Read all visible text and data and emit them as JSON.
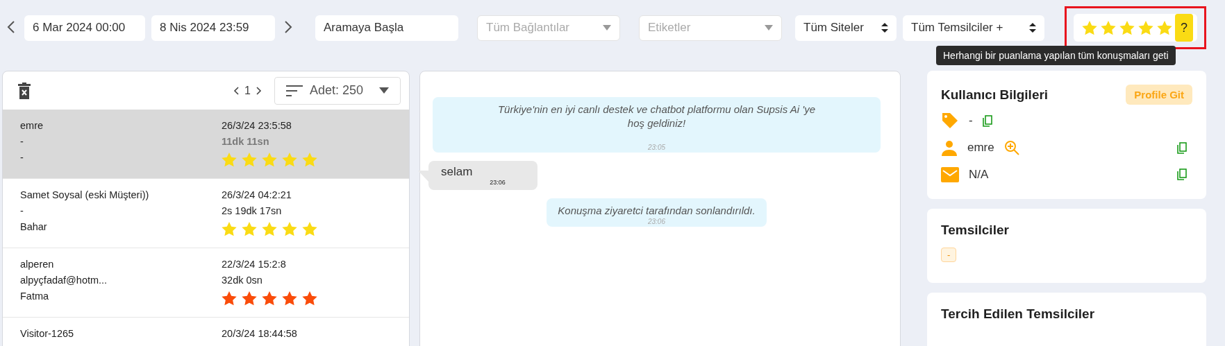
{
  "filters": {
    "start_date": "6 Mar 2024 00:00",
    "end_date": "8 Nis 2024 23:59",
    "search": {
      "value": "Aramaya Başla"
    },
    "selects": [
      {
        "kind": "dropdown",
        "placeholder": "Tüm Bağlantılar"
      },
      {
        "kind": "dropdown",
        "placeholder": "Etiketler"
      },
      {
        "kind": "sorter",
        "value": "Tüm Siteler"
      },
      {
        "kind": "sorter",
        "value": "Tüm Temsilciler +"
      }
    ],
    "rating": {
      "stars": 5,
      "help": "?",
      "highlighted": true
    },
    "tooltip": "Herhangi bir puanlama yapılan tüm konuşmaları geti"
  },
  "list": {
    "page": "1",
    "count": "Adet: 250",
    "rows": [
      {
        "name": "emre",
        "line_2": "-",
        "line_3": "-",
        "date": "26/3/24 23:5:58",
        "duration": "11dk 11sn",
        "stars": 5,
        "color": "#fadb14",
        "selected": true
      },
      {
        "name": "Samet Soysal (eski Müşteri))",
        "line_2": "-",
        "line_3": "Bahar",
        "date": "26/3/24 04:2:21",
        "duration": "2s 19dk 17sn",
        "stars": 5,
        "color": "#fadb14",
        "selected": false
      },
      {
        "name": "alperen",
        "line_2": "alpyçfadaf@hotm...",
        "line_3": "Fatma",
        "date": "22/3/24 15:2:8",
        "duration": "32dk 0sn",
        "stars": 5,
        "color": "#fa4c0a",
        "selected": false
      },
      {
        "name": "Visitor-1265",
        "date": "20/3/24 18:44:58",
        "selected": false
      }
    ]
  },
  "chat": [
    {
      "kind": "system",
      "text": "Türkiye'nin en iyi canlı destek ve chatbot platformu olan Supsis Ai 'ye hoş geldiniz!",
      "time": "23:05"
    },
    {
      "kind": "visitor",
      "text": "selam",
      "time": "23:06"
    },
    {
      "kind": "system",
      "text": "Konuşma ziyaretci tarafından sonlandırıldı.",
      "time": "23:06"
    }
  ],
  "user_info": {
    "title": "Kullanıcı Bilgileri",
    "button": "Profile Git",
    "rows": [
      {
        "kind": "tag",
        "value": "-"
      },
      {
        "kind": "user",
        "value": "emre"
      },
      {
        "kind": "email",
        "value": "N/A"
      }
    ]
  },
  "agents": {
    "title": "Temsilciler",
    "chips": [
      "-"
    ]
  },
  "preferred_agents": {
    "title": "Tercih Edilen Temsilciler"
  }
}
